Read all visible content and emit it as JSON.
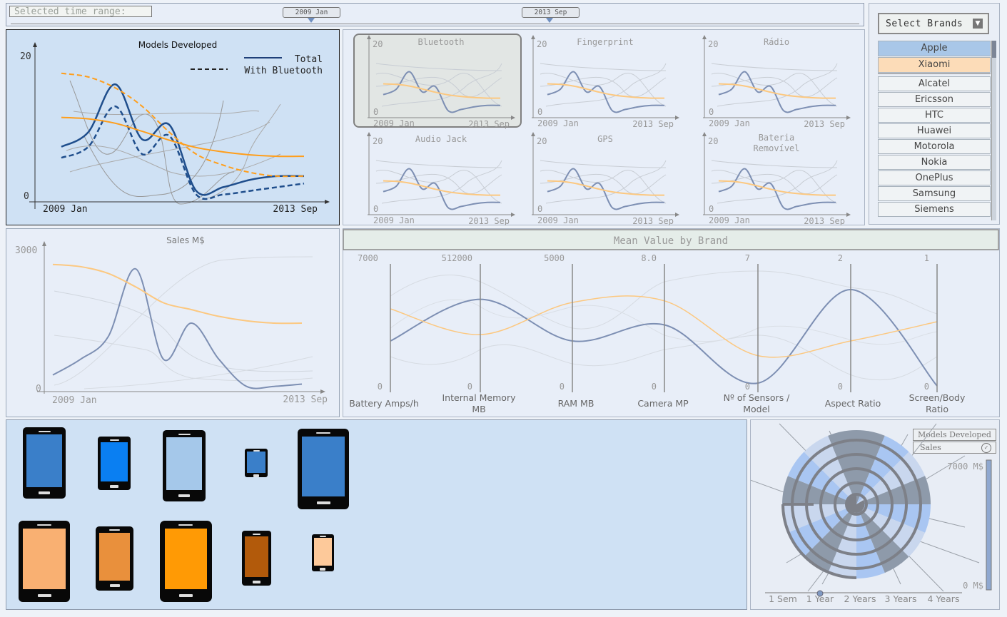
{
  "time_range": {
    "label": "Selected time range:",
    "start": "2009 Jan",
    "end": "2013 Sep"
  },
  "brands": {
    "select_label": "Select Brands",
    "selected": [
      {
        "name": "Apple",
        "color": "#a9c7e8"
      },
      {
        "name": "Xiaomi",
        "color": "#fcdcb8"
      }
    ],
    "list": [
      "Alcatel",
      "Ericsson",
      "HTC",
      "Huawei",
      "Motorola",
      "Nokia",
      "OnePlus",
      "Samsung",
      "Siemens"
    ]
  },
  "colors": {
    "apple": "#1f4e8c",
    "xiaomi": "#ff9e1b",
    "grey": "#8f8f8f",
    "apple_light": "#7d8fb3",
    "xiaomi_light": "#fcc880"
  },
  "models": {
    "title": "Models Developed",
    "legend_total": "Total",
    "legend_bt": "With Bluetooth"
  },
  "small_multiples": {
    "titles": [
      "Bluetooth",
      "Fingerprint",
      "Rádio",
      "Audio Jack",
      "GPS",
      "Bateria Removível"
    ]
  },
  "sales": {
    "title": "Sales M$"
  },
  "parallel": {
    "title": "Mean Value by Brand"
  },
  "radial": {
    "toggle_models": "Models Developed",
    "toggle_sales": "Sales",
    "scale_max": "7000 M$",
    "scale_min": "0 M$",
    "periods": [
      "1 Sem",
      "1 Year",
      "2 Years",
      "3 Years",
      "4 Years"
    ],
    "selected_period": "1 Year"
  },
  "phones": {
    "rows": [
      [
        {
          "brand": "Apple",
          "color": "#3a7fc9"
        },
        {
          "brand": "Apple",
          "color": "#0a7ff2"
        },
        {
          "brand": "Apple",
          "color": "#a5c8ea"
        },
        {
          "brand": "Apple",
          "color": "#3a7fc9"
        },
        {
          "brand": "Apple",
          "color": "#3a7fc9"
        }
      ],
      [
        {
          "brand": "Xiaomi",
          "color": "#f9b072"
        },
        {
          "brand": "Xiaomi",
          "color": "#e9903c"
        },
        {
          "brand": "Xiaomi",
          "color": "#ff9a05"
        },
        {
          "brand": "Xiaomi",
          "color": "#b25a0b"
        },
        {
          "brand": "Xiaomi",
          "color": "#fdc99a"
        }
      ]
    ]
  },
  "chart_data": [
    {
      "type": "line",
      "title": "Models Developed",
      "x_ticks": [
        "2009 Jan",
        "2013 Sep"
      ],
      "y_ticks": [
        "0",
        "20"
      ],
      "ylim": [
        0,
        20
      ],
      "x": [
        "2009 Jan",
        "2009 Jul",
        "2010 Jan",
        "2010 Jul",
        "2011 Jan",
        "2011 Jul",
        "2012 Jan",
        "2012 Jul",
        "2013 Jan",
        "2013 Sep"
      ],
      "series": [
        {
          "name": "Total",
          "brand": "Apple",
          "values": [
            7.5,
            9.5,
            16,
            8.5,
            10.5,
            1.5,
            2,
            3,
            3.5,
            3.5
          ]
        },
        {
          "name": "With Bluetooth",
          "brand": "Apple",
          "values": [
            6,
            7.5,
            13,
            6.5,
            9,
            1,
            1,
            1.5,
            2,
            2.5
          ]
        },
        {
          "name": "Total",
          "brand": "Xiaomi",
          "values": [
            11.5,
            11.3,
            10.7,
            9.6,
            8.4,
            7.4,
            6.8,
            6.4,
            6.2,
            6.2
          ]
        },
        {
          "name": "With Bluetooth",
          "brand": "Xiaomi",
          "values": [
            17.5,
            17,
            15.5,
            13,
            9.5,
            6.5,
            5,
            4,
            3.5,
            3.5
          ]
        }
      ]
    },
    {
      "type": "line",
      "title": "Sales M$",
      "x_ticks": [
        "2009 Jan",
        "2013 Sep"
      ],
      "y_ticks": [
        "0",
        "3000"
      ],
      "ylim": [
        0,
        3000
      ],
      "x": [
        "2009 Jan",
        "2009 Jul",
        "2010 Jan",
        "2010 Jul",
        "2011 Jan",
        "2011 Jul",
        "2012 Jan",
        "2012 Jul",
        "2013 Jan",
        "2013 Sep"
      ],
      "series": [
        {
          "brand": "Apple",
          "values": [
            350,
            700,
            1200,
            2700,
            700,
            1500,
            700,
            100,
            100,
            150
          ]
        },
        {
          "brand": "Xiaomi",
          "values": [
            2800,
            2750,
            2600,
            2300,
            1950,
            1800,
            1650,
            1550,
            1500,
            1500
          ]
        }
      ]
    },
    {
      "type": "line",
      "title": "Mean Value by Brand",
      "axes": [
        {
          "label": "Battery Amps/h",
          "max": "7000",
          "min": "0"
        },
        {
          "label": "Internal Memory MB",
          "max": "512000",
          "min": "0"
        },
        {
          "label": "RAM MB",
          "max": "5000",
          "min": "0"
        },
        {
          "label": "Camera MP",
          "max": "8.0",
          "min": "0"
        },
        {
          "label": "Nº of Sensors / Model",
          "max": "7",
          "min": "0"
        },
        {
          "label": "Aspect Ratio",
          "max": "2",
          "min": "0"
        },
        {
          "label": "Screen/Body Ratio",
          "max": "1",
          "min": "0"
        }
      ],
      "series": [
        {
          "brand": "Apple",
          "values": [
            2800,
            371000,
            2000,
            4.2,
            0.5,
            1.6,
            0.05
          ]
        },
        {
          "brand": "Xiaomi",
          "values": [
            4550,
            230000,
            3500,
            5.7,
            2.0,
            0.8,
            0.55
          ]
        }
      ]
    }
  ]
}
